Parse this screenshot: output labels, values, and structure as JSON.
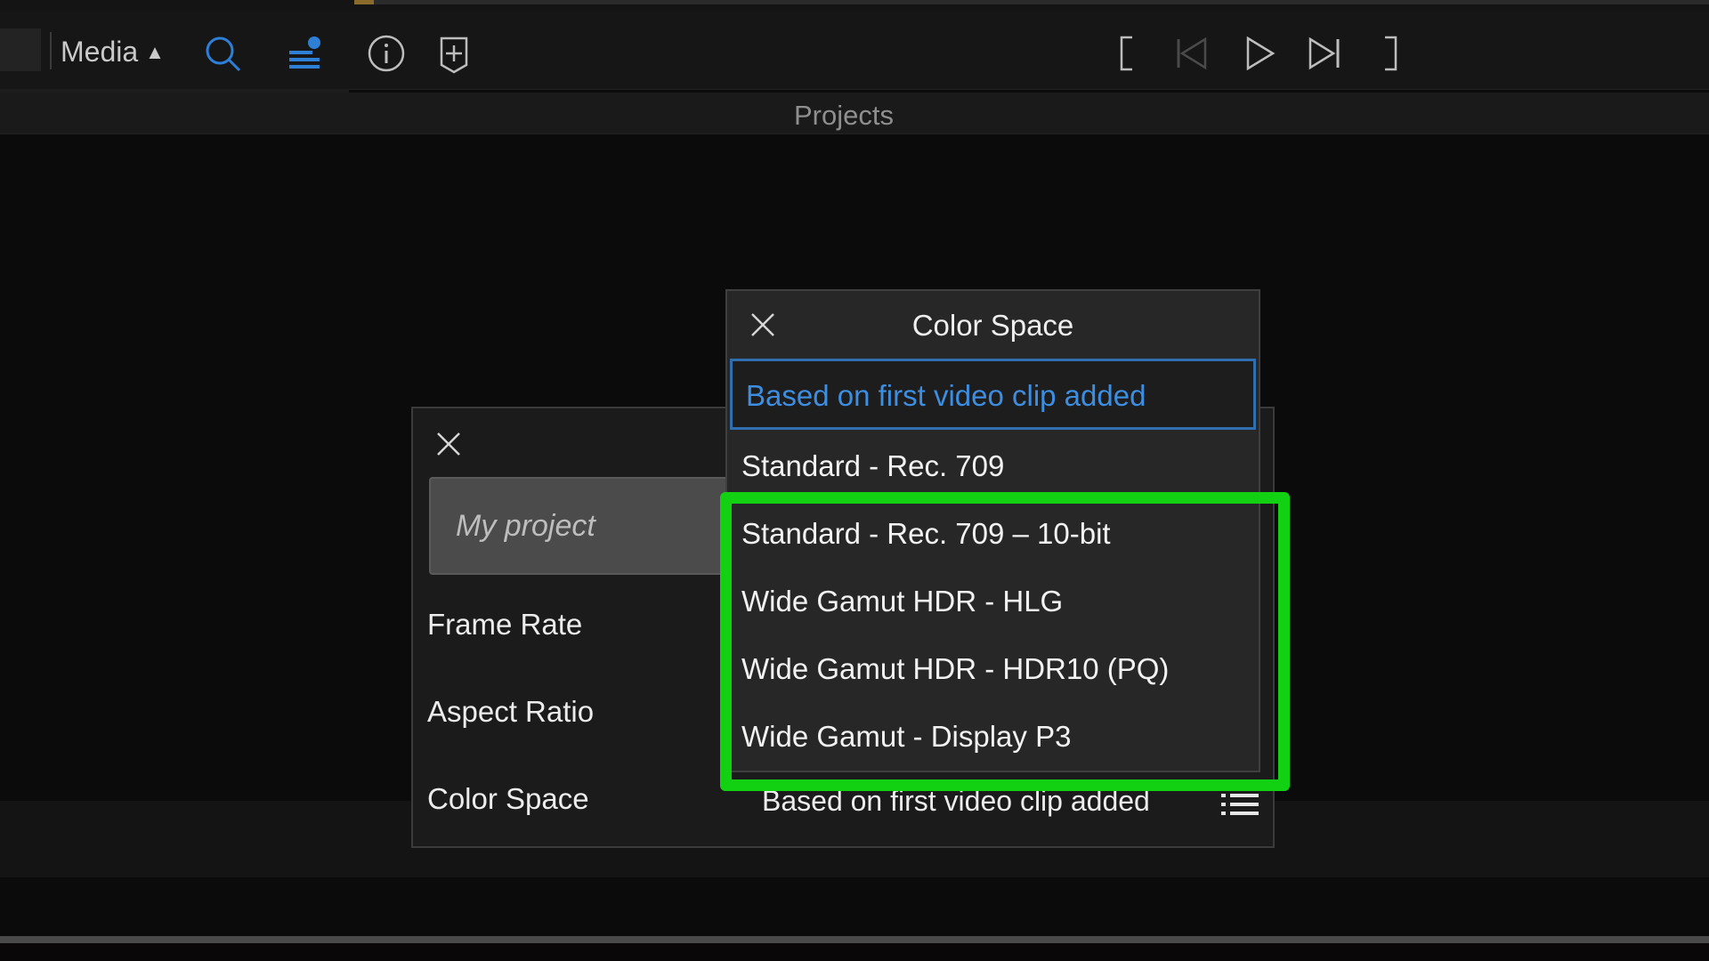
{
  "toolbar": {
    "media_label": "Media",
    "icons": [
      "search-icon",
      "layers-icon",
      "info-icon",
      "add-marker-icon",
      "mark-in-icon",
      "skip-back-icon",
      "play-icon",
      "skip-forward-icon",
      "mark-out-icon"
    ]
  },
  "projects_title": "Projects",
  "project_dialog": {
    "name_placeholder": "My project",
    "frame_rate_label": "Frame Rate",
    "aspect_ratio_label": "Aspect Ratio",
    "color_space_label": "Color Space",
    "color_space_value": "Based on first video clip added"
  },
  "color_space_popup": {
    "title": "Color Space",
    "selected": "Based on first video clip added",
    "options": [
      "Standard - Rec. 709",
      "Standard - Rec. 709 – 10-bit",
      "Wide Gamut HDR - HLG",
      "Wide Gamut HDR - HDR10 (PQ)",
      "Wide Gamut - Display P3"
    ]
  },
  "colors": {
    "accent_blue": "#3d8ee0",
    "highlight_green": "#12d012",
    "background": "#0b0b0b"
  }
}
